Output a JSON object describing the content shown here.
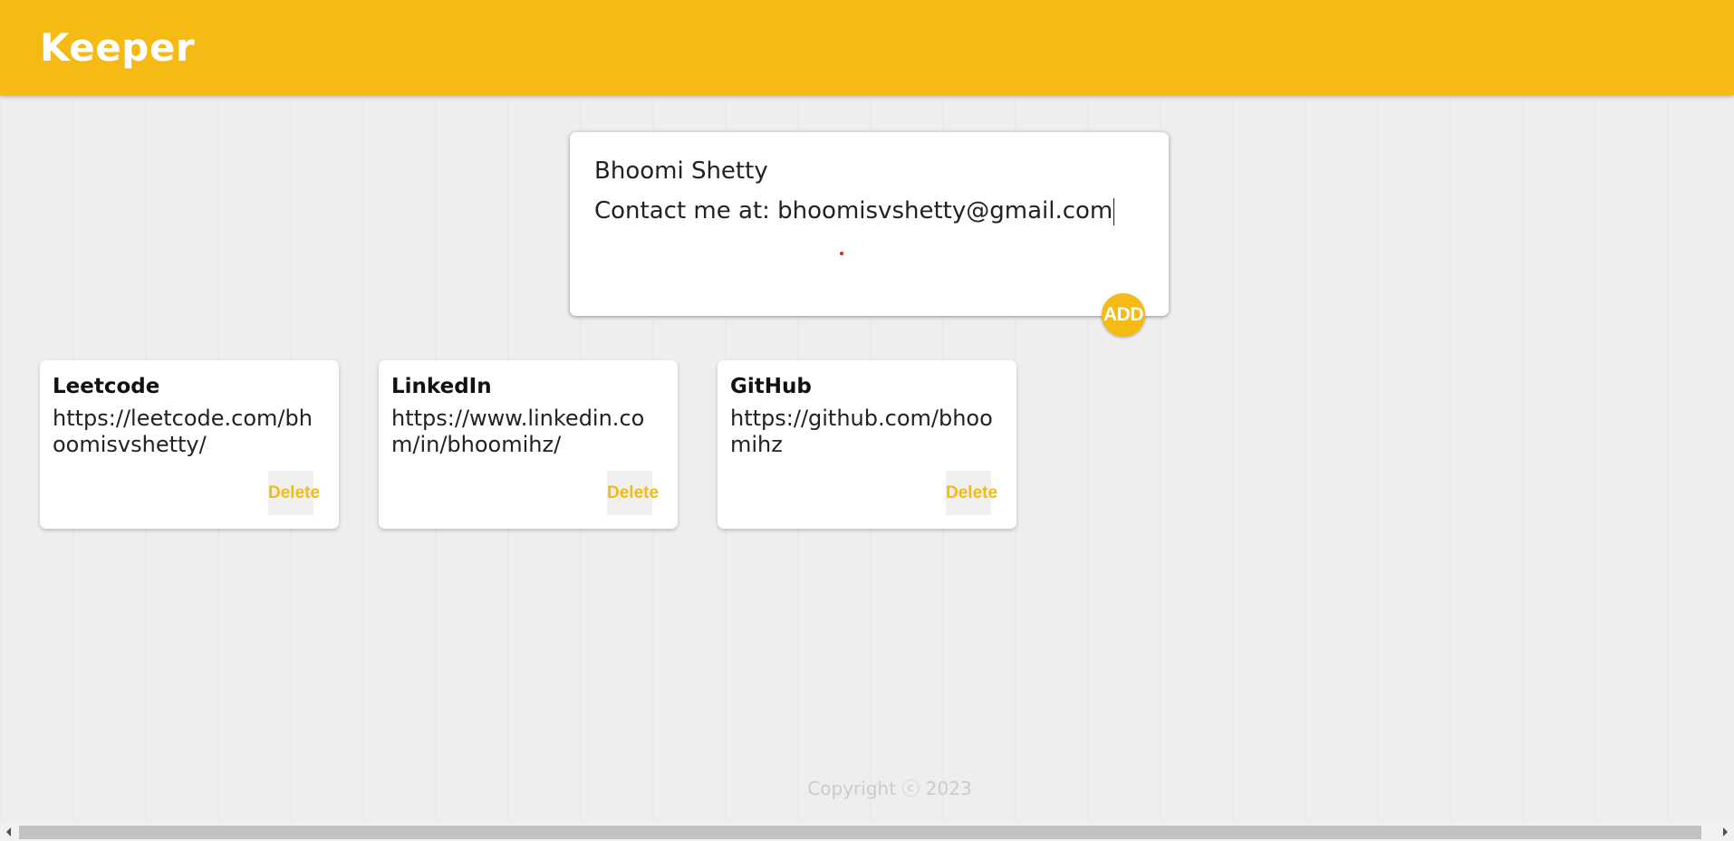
{
  "app": {
    "title": "Keeper"
  },
  "create_note": {
    "title_value": "Bhoomi Shetty",
    "content_value": "Contact me at: bhoomisvshetty@gmail.com",
    "add_label": "ADD"
  },
  "notes": [
    {
      "title": "Leetcode",
      "content": "https://leetcode.com/bhoomisvshetty/",
      "delete_label": "Delete"
    },
    {
      "title": "LinkedIn",
      "content": "https://www.linkedin.com/in/bhoomihz/",
      "delete_label": "Delete"
    },
    {
      "title": "GitHub",
      "content": "https://github.com/bhoomihz",
      "delete_label": "Delete"
    }
  ],
  "footer": {
    "copyright": "Copyright ⓒ 2023"
  },
  "colors": {
    "accent": "#f5ba13",
    "background": "#eeeeee",
    "card": "#ffffff"
  },
  "icons": {
    "scroll_left": "chevron-left-icon",
    "scroll_right": "chevron-right-icon"
  }
}
